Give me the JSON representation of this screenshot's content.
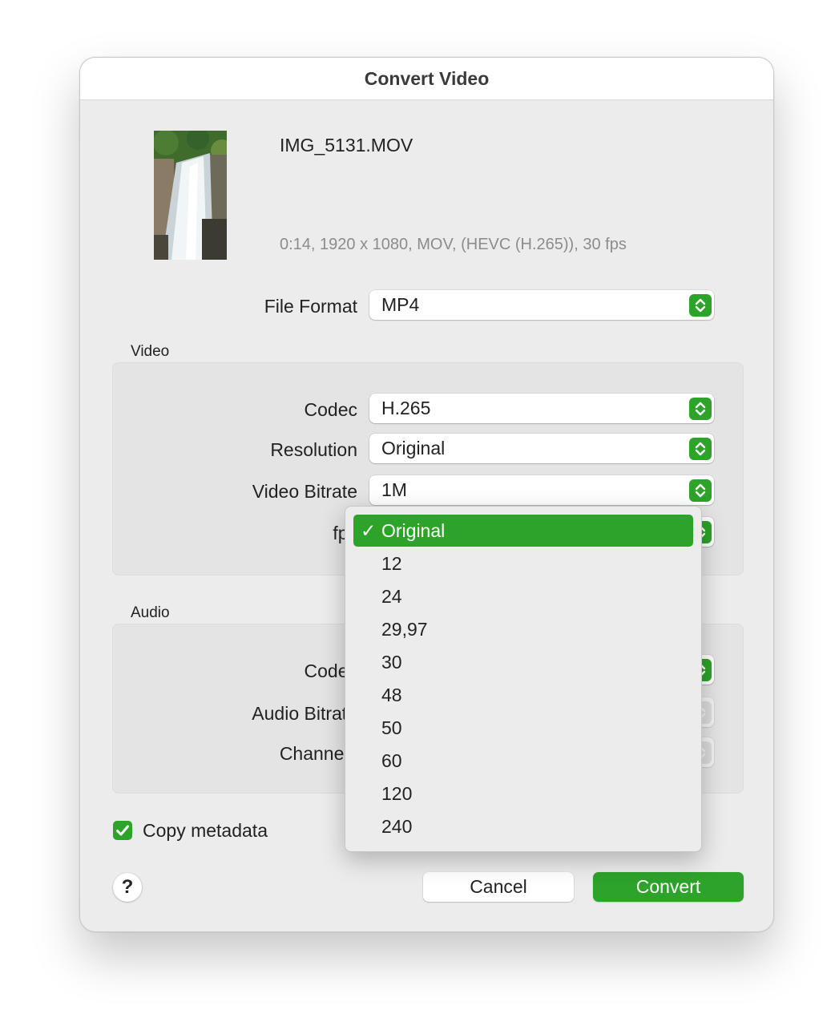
{
  "window": {
    "title": "Convert Video"
  },
  "file": {
    "name": "IMG_5131.MOV",
    "info": "0:14, 1920 x 1080, MOV, (HEVC (H.265)), 30 fps"
  },
  "file_format": {
    "label": "File Format",
    "value": "MP4"
  },
  "video": {
    "section_title": "Video",
    "codec": {
      "label": "Codec",
      "value": "H.265"
    },
    "resolution": {
      "label": "Resolution",
      "value": "Original"
    },
    "bitrate": {
      "label": "Video Bitrate",
      "value": "1M"
    },
    "fps": {
      "label": "fps"
    }
  },
  "audio": {
    "section_title": "Audio",
    "codec": {
      "label": "Codec"
    },
    "bitrate": {
      "label": "Audio Bitrate"
    },
    "channels": {
      "label": "Channels"
    }
  },
  "fps_menu": {
    "options": [
      "Original",
      "12",
      "24",
      "29,97",
      "30",
      "48",
      "50",
      "60",
      "120",
      "240"
    ],
    "selected": "Original",
    "check_glyph": "✓"
  },
  "copy_metadata": {
    "label": "Copy metadata",
    "checked": true
  },
  "buttons": {
    "help": "?",
    "cancel": "Cancel",
    "convert": "Convert"
  },
  "colors": {
    "accent": "#2da32a",
    "background": "#ececec"
  }
}
